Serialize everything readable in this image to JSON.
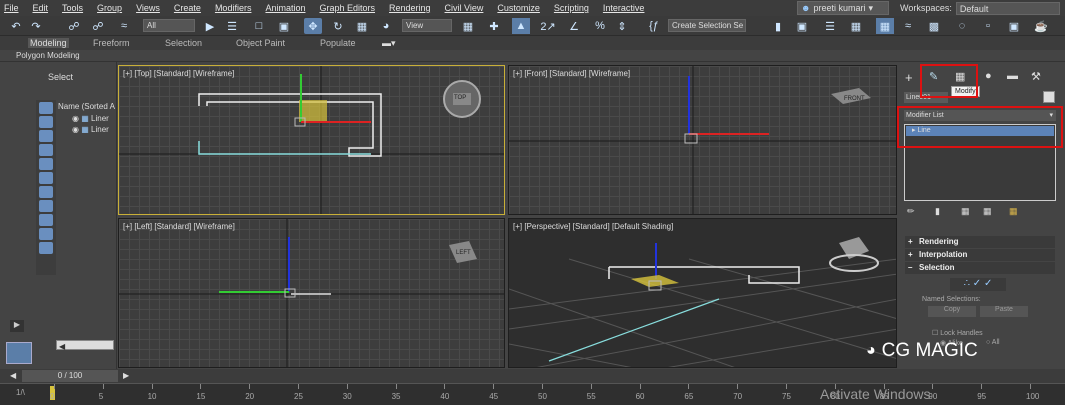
{
  "menu": [
    "File",
    "Edit",
    "Tools",
    "Group",
    "Views",
    "Create",
    "Modifiers",
    "Animation",
    "Graph Editors",
    "Rendering",
    "Civil View",
    "Customize",
    "Scripting",
    "Interactive"
  ],
  "user_name": "preeti kumari",
  "workspaces_label": "Workspaces:",
  "workspaces_value": "Default",
  "toolbar": {
    "selection_filter": "All",
    "view_dropdown": "View",
    "create_selection_set": "Create Selection Se"
  },
  "ribbon_tabs": [
    "Modeling",
    "Freeform",
    "Selection",
    "Object Paint",
    "Populate"
  ],
  "ribbon_sub": "Polygon Modeling",
  "scene_explorer": {
    "select_label": "Select",
    "name_header": "Name (Sorted A",
    "items": [
      "Liner",
      "Liner"
    ]
  },
  "viewports": {
    "top": "[+] [Top] [Standard] [Wireframe]",
    "front": "[+] [Front] [Standard] [Wireframe]",
    "left": "[+] [Left] [Standard] [Wireframe]",
    "perspective": "[+] [Perspective] [Standard] [Default Shading]"
  },
  "viewcube": {
    "top": "TOP",
    "front": "FRONT",
    "left": "LEFT"
  },
  "command_panel": {
    "tooltip": "Modify",
    "object_name": "Line001",
    "modifier_list": "Modifier List",
    "stack_item": "Line",
    "rollouts": [
      "Rendering",
      "Interpolation",
      "Selection"
    ],
    "named_selections": "Named Selections:",
    "copy": "Copy",
    "paste": "Paste",
    "lock_handles": "Lock Handles",
    "alike": "Alike",
    "all": "All"
  },
  "time_slider": {
    "value": "0 / 100"
  },
  "trackbar_ticks": [
    "0",
    "5",
    "10",
    "15",
    "20",
    "25",
    "30",
    "35",
    "40",
    "45",
    "50",
    "55",
    "60",
    "65",
    "70",
    "75",
    "80",
    "85",
    "90",
    "95",
    "100"
  ],
  "watermark_activate": "Activate Windows",
  "watermark_brand": "CG MAGIC",
  "colors": {
    "accent_blue": "#5aa2ff",
    "selection_red": "#d11",
    "active_border": "#c9b038"
  }
}
